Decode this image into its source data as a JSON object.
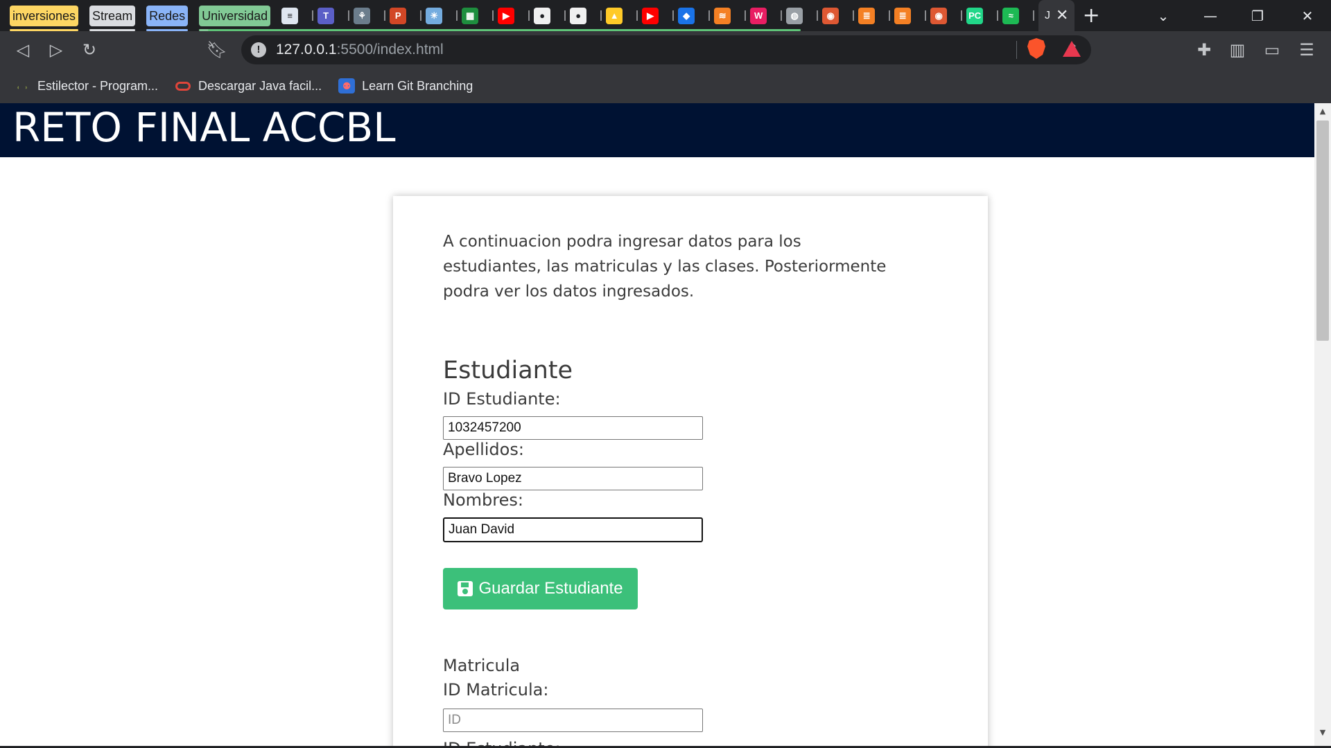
{
  "browser": {
    "tab_groups": [
      {
        "label": "inversiones",
        "color": "#fdd663"
      },
      {
        "label": "Stream",
        "color": "#dadce0"
      },
      {
        "label": "Redes",
        "color": "#8ab4f8"
      },
      {
        "label": "Universidad",
        "color": "#81c995"
      }
    ],
    "mini_tabs": [
      {
        "icon": "doc-icon",
        "color": "#dfe6f0"
      },
      {
        "icon": "teams-icon",
        "color": "#5b5fc7"
      },
      {
        "icon": "gov-icon",
        "color": "#6b7d8c"
      },
      {
        "icon": "powerpoint-icon",
        "color": "#d24726"
      },
      {
        "icon": "flag-icon",
        "color": "#74acdf"
      },
      {
        "icon": "calc-icon",
        "color": "#1e8e3e"
      },
      {
        "icon": "youtube-icon",
        "color": "#ff0000"
      },
      {
        "icon": "github-icon",
        "color": "#f0f0f0"
      },
      {
        "icon": "github-icon",
        "color": "#f0f0f0"
      },
      {
        "icon": "firebase-icon",
        "color": "#ffca28"
      },
      {
        "icon": "youtube-icon",
        "color": "#ff0000"
      },
      {
        "icon": "shield-icon",
        "color": "#1a73e8"
      },
      {
        "icon": "stack-icon",
        "color": "#f48024"
      },
      {
        "icon": "wg-icon",
        "color": "#e91e63"
      },
      {
        "icon": "globe-icon",
        "color": "#9aa0a6"
      },
      {
        "icon": "duckduckgo-icon",
        "color": "#de5833"
      },
      {
        "icon": "stackoverflow-icon",
        "color": "#f48024"
      },
      {
        "icon": "stackoverflow-icon",
        "color": "#f48024"
      },
      {
        "icon": "duckduckgo-icon",
        "color": "#de5833"
      },
      {
        "icon": "pycharm-icon",
        "color": "#21d789"
      },
      {
        "icon": "spotify-icon",
        "color": "#1db954"
      }
    ],
    "active_tab_title": "J",
    "url_host": "127.0.0.1",
    "url_rest": ":5500/index.html",
    "bookmarks": [
      {
        "label": "Estilector - Program...",
        "icon": "estilector-icon"
      },
      {
        "label": "Descargar Java facil...",
        "icon": "oracle-icon"
      },
      {
        "label": "Learn Git Branching",
        "icon": "git-branch-icon"
      }
    ]
  },
  "page": {
    "header_title": "RETO FINAL ACCBL",
    "intro": "A continuacion podra ingresar datos para los estudiantes, las matriculas y las clases. Posteriormente podra ver los datos ingresados.",
    "estudiante": {
      "title": "Estudiante",
      "id_label": "ID Estudiante:",
      "id_value": "1032457200",
      "apellidos_label": "Apellidos:",
      "apellidos_value": "Bravo Lopez",
      "nombres_label": "Nombres:",
      "nombres_value": "Juan David",
      "save_label": "Guardar Estudiante"
    },
    "matricula": {
      "title": "Matricula",
      "id_label": "ID Matricula:",
      "id_placeholder": "ID",
      "id_estudiante_label": "ID Estudiante:"
    }
  }
}
